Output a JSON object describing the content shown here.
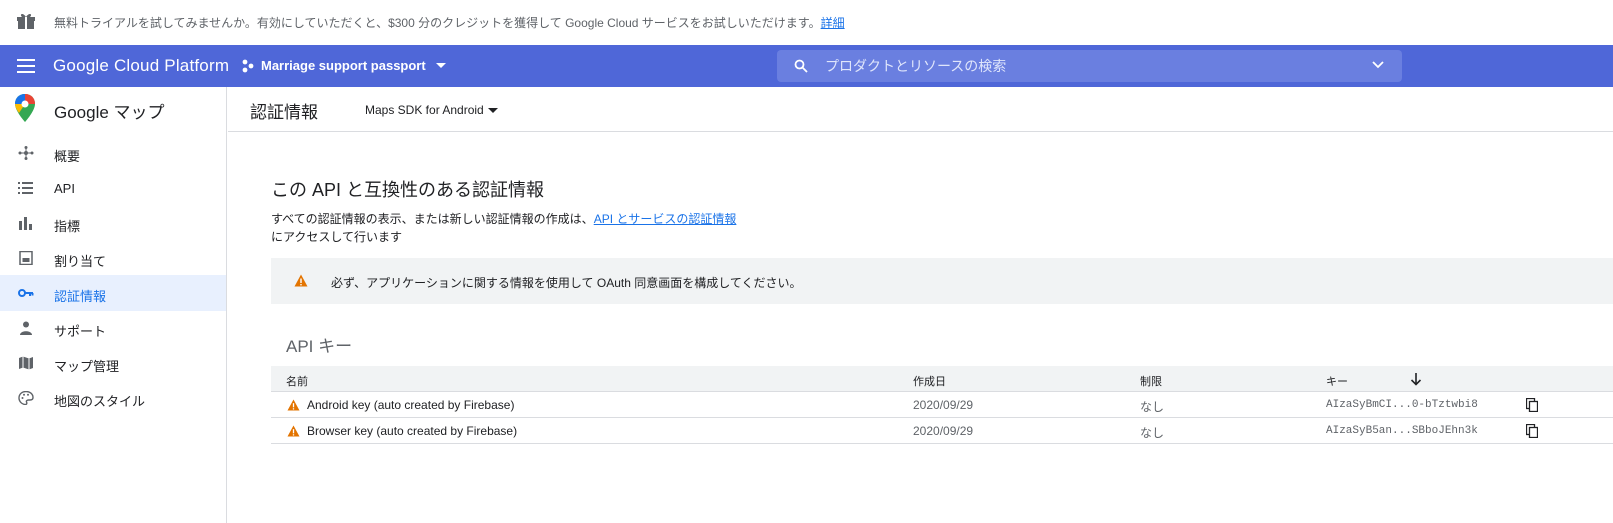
{
  "promo": {
    "text": "無料トライアルを試してみませんか。有効にしていただくと、$300 分のクレジットを獲得して Google Cloud サービスをお試しいただけます。",
    "link": "詳細",
    "icon": "gift-icon"
  },
  "header": {
    "brand": "Google Cloud Platform",
    "project": "Marriage support passport",
    "search_placeholder": "プロダクトとリソースの検索",
    "color": "#4f67d8"
  },
  "sidebar": {
    "title": "Google マップ",
    "items": [
      {
        "label": "概要",
        "icon": "overview-icon"
      },
      {
        "label": "API",
        "icon": "list-icon"
      },
      {
        "label": "指標",
        "icon": "bar-chart-icon"
      },
      {
        "label": "割り当て",
        "icon": "quota-icon"
      },
      {
        "label": "認証情報",
        "icon": "key-icon",
        "active": true
      },
      {
        "label": "サポート",
        "icon": "person-icon"
      },
      {
        "label": "マップ管理",
        "icon": "map-icon"
      },
      {
        "label": "地図のスタイル",
        "icon": "palette-icon"
      }
    ]
  },
  "content": {
    "page_title": "認証情報",
    "api_selector": "Maps SDK for Android",
    "heading": "この API と互換性のある認証情報",
    "desc_prefix": "すべての認証情報の表示、または新しい認証情報の作成は、",
    "desc_link": "API とサービスの認証情報",
    "desc_suffix": "にアクセスして行います",
    "warning": "必ず、アプリケーションに関する情報を使用して OAuth 同意画面を構成してください。",
    "section_title": "API キー"
  },
  "table": {
    "headers": {
      "name": "名前",
      "created": "作成日",
      "restriction": "制限",
      "key": "キー"
    },
    "rows": [
      {
        "name": "Android key (auto created by Firebase)",
        "created": "2020/09/29",
        "restriction": "なし",
        "key": "AIzaSyBmCI...0-bTztwbi8"
      },
      {
        "name": "Browser key (auto created by Firebase)",
        "created": "2020/09/29",
        "restriction": "なし",
        "key": "AIzaSyB5an...SBboJEhn3k"
      }
    ]
  },
  "colors": {
    "accent": "#1a73e8",
    "warning": "#e37400"
  }
}
